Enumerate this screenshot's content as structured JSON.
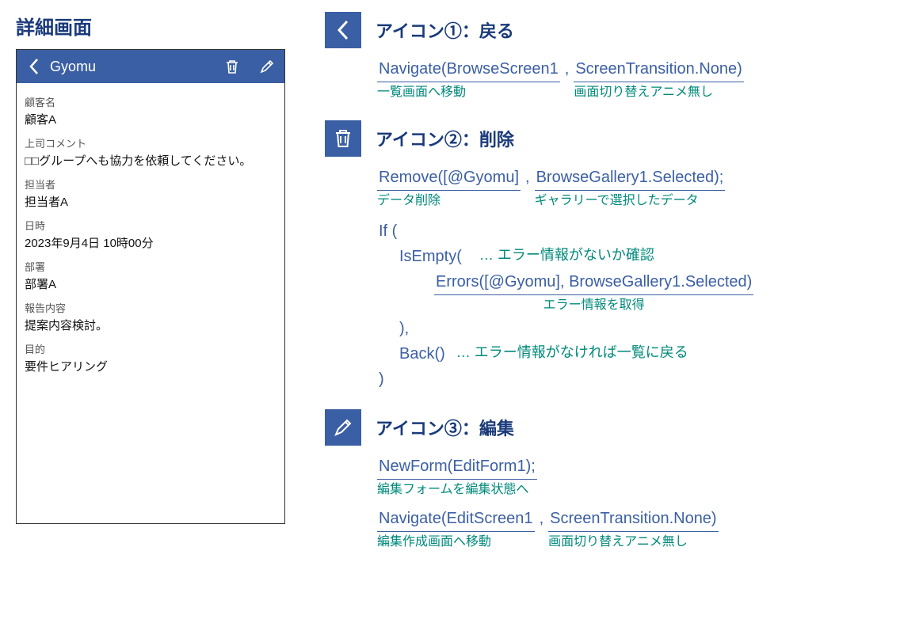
{
  "pageTitle": "詳細画面",
  "phone": {
    "headerTitle": "Gyomu",
    "fields": [
      {
        "label": "顧客名",
        "value": "顧客A"
      },
      {
        "label": "上司コメント",
        "value": "□□グループへも協力を依頼してください。"
      },
      {
        "label": "担当者",
        "value": "担当者A"
      },
      {
        "label": "日時",
        "value": "2023年9月4日 10時00分"
      },
      {
        "label": "部署",
        "value": "部署A"
      },
      {
        "label": "報告内容",
        "value": "提案内容検討。"
      },
      {
        "label": "目的",
        "value": "要件ヒアリング"
      }
    ]
  },
  "sections": {
    "back": {
      "title": "アイコン①：戻る",
      "code1": "Navigate(BrowseScreen1",
      "comma": ",",
      "code2": "ScreenTransition.None)",
      "note1": "一覧画面へ移動",
      "note2": "画面切り替えアニメ無し"
    },
    "delete": {
      "title": "アイコン②：削除",
      "code1": "Remove([@Gyomu]",
      "comma1": ",",
      "code2": "BrowseGallery1.Selected);",
      "note1": "データ削除",
      "note2": "ギャラリーで選択したデータ",
      "ifOpen": "If (",
      "isEmpty": "IsEmpty(",
      "isEmptyNote": "… エラー情報がないか確認",
      "errors": "Errors([@Gyomu], BrowseGallery1.Selected)",
      "errorsNote": "エラー情報を取得",
      "closeParen": "),",
      "back": "Back()",
      "backNote": "… エラー情報がなければ一覧に戻る",
      "finalClose": ")"
    },
    "edit": {
      "title": "アイコン③：編集",
      "code1": "NewForm(EditForm1);",
      "note1": "編集フォームを編集状態へ",
      "code2": "Navigate(EditScreen1",
      "comma": ",",
      "code3": "ScreenTransition.None)",
      "note2": "編集作成画面へ移動",
      "note3": "画面切り替えアニメ無し"
    }
  }
}
